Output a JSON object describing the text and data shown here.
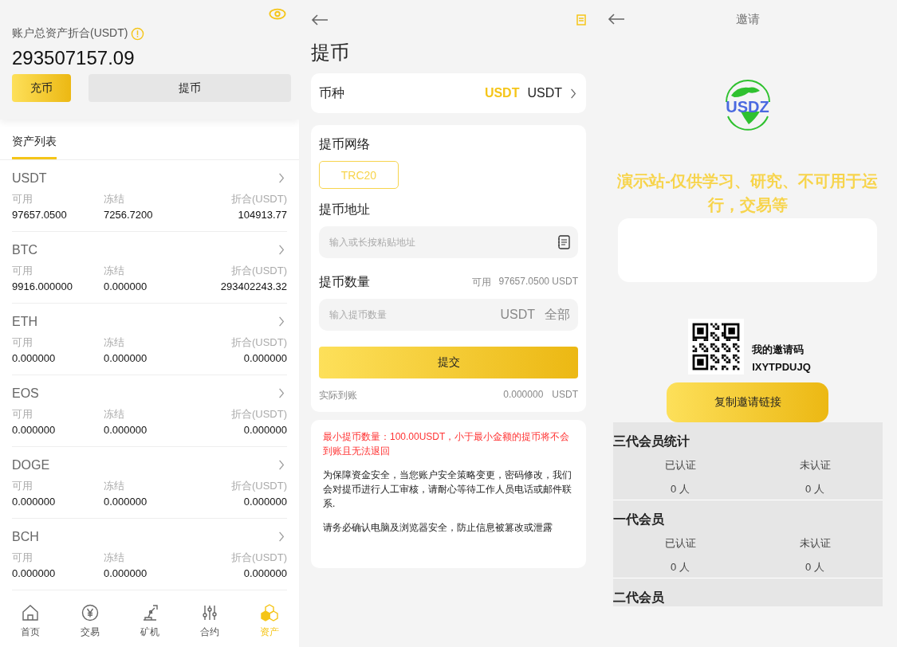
{
  "assets": {
    "total_label": "账户总资产折合(USDT)",
    "total": "293507157.09",
    "buttons": [
      {
        "label": "充币",
        "kind": "primary"
      },
      {
        "label": "提币",
        "kind": "secondary"
      }
    ],
    "tab": "资产列表",
    "coins": [
      {
        "name": "USDT",
        "cols": [
          {
            "label": "可用",
            "value": "97657.0500"
          },
          {
            "label": "冻结",
            "value": "7256.7200"
          },
          {
            "label": "折合(USDT)",
            "value": "104913.77"
          }
        ]
      },
      {
        "name": "BTC",
        "cols": [
          {
            "label": "可用",
            "value": "9916.000000"
          },
          {
            "label": "冻结",
            "value": "0.000000"
          },
          {
            "label": "折合(USDT)",
            "value": "293402243.32"
          }
        ]
      },
      {
        "name": "ETH",
        "cols": [
          {
            "label": "可用",
            "value": "0.000000"
          },
          {
            "label": "冻结",
            "value": "0.000000"
          },
          {
            "label": "折合(USDT)",
            "value": "0.000000"
          }
        ]
      },
      {
        "name": "EOS",
        "cols": [
          {
            "label": "可用",
            "value": "0.000000"
          },
          {
            "label": "冻结",
            "value": "0.000000"
          },
          {
            "label": "折合(USDT)",
            "value": "0.000000"
          }
        ]
      },
      {
        "name": "DOGE",
        "cols": [
          {
            "label": "可用",
            "value": "0.000000"
          },
          {
            "label": "冻结",
            "value": "0.000000"
          },
          {
            "label": "折合(USDT)",
            "value": "0.000000"
          }
        ]
      },
      {
        "name": "BCH",
        "cols": [
          {
            "label": "可用",
            "value": "0.000000"
          },
          {
            "label": "冻结",
            "value": "0.000000"
          },
          {
            "label": "折合(USDT)",
            "value": "0.000000"
          }
        ]
      }
    ],
    "nav": [
      {
        "label": "首页",
        "kind": "home",
        "selected": false
      },
      {
        "label": "交易",
        "kind": "trade",
        "selected": false
      },
      {
        "label": "矿机",
        "kind": "miner",
        "selected": false
      },
      {
        "label": "合约",
        "kind": "contract",
        "selected": false
      },
      {
        "label": "资产",
        "kind": "assets",
        "selected": true
      }
    ]
  },
  "withdraw": {
    "title": "提币",
    "coin": {
      "label": "币种",
      "highlight": "USDT",
      "value": "USDT"
    },
    "network": {
      "label": "提币网络",
      "options": [
        {
          "label": "TRC20",
          "selected": true
        }
      ]
    },
    "address": {
      "label": "提币地址",
      "placeholder": "输入或长按粘贴地址"
    },
    "amount": {
      "label": "提币数量",
      "available_label": "可用",
      "available": "97657.0500 USDT",
      "placeholder": "输入提币数量",
      "unit": "USDT",
      "all": "全部"
    },
    "submit": "提交",
    "received": {
      "label": "实际到账",
      "value": "0.000000",
      "unit": "USDT"
    },
    "warning": "最小提币数量：100.00USDT，小于最小金额的提币将不会到账且无法退回",
    "notes": [
      "为保障资金安全，当您账户安全策略变更，密码修改，我们会对提币进行人工审核，请耐心等待工作人员电话或邮件联系.",
      "请务必确认电脑及浏览器安全，防止信息被篡改或泄露"
    ]
  },
  "invite": {
    "title": "邀请",
    "logo": "USDZ",
    "banner": "演示站-仅供学习、研究、不可用于运行，交易等",
    "code_label": "我的邀请码",
    "code": "IXYTPDUJQ",
    "copy_button": "复制邀请链接",
    "sections": [
      {
        "title": "三代会员统计",
        "stats": [
          {
            "label": "已认证",
            "value": "0 人"
          },
          {
            "label": "未认证",
            "value": "0 人"
          }
        ]
      },
      {
        "title": "一代会员",
        "stats": [
          {
            "label": "已认证",
            "value": "0 人"
          },
          {
            "label": "未认证",
            "value": "0 人"
          }
        ]
      },
      {
        "title": "二代会员"
      }
    ]
  }
}
